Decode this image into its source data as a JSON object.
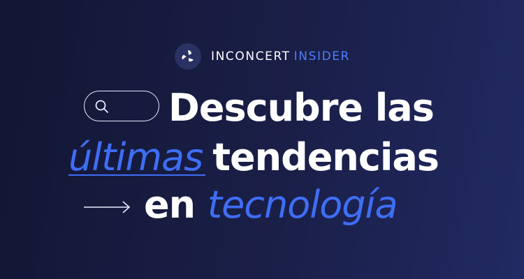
{
  "brand": {
    "name_primary": "INCONCERT",
    "name_accent": "INSIDER",
    "logo_icon": "inconcert-logo-icon"
  },
  "headline": {
    "line1": "Descubre las",
    "line2_highlight": "últimas",
    "line2_rest": "tendencias",
    "line3_plain": "en",
    "line3_highlight": "tecnología"
  },
  "decorations": {
    "search_icon": "search-icon",
    "arrow_icon": "arrow-right-icon"
  },
  "colors": {
    "background_start": "#121633",
    "background_end": "#212a62",
    "accent_blue": "#3f6ef5",
    "text_white": "#ffffff"
  }
}
